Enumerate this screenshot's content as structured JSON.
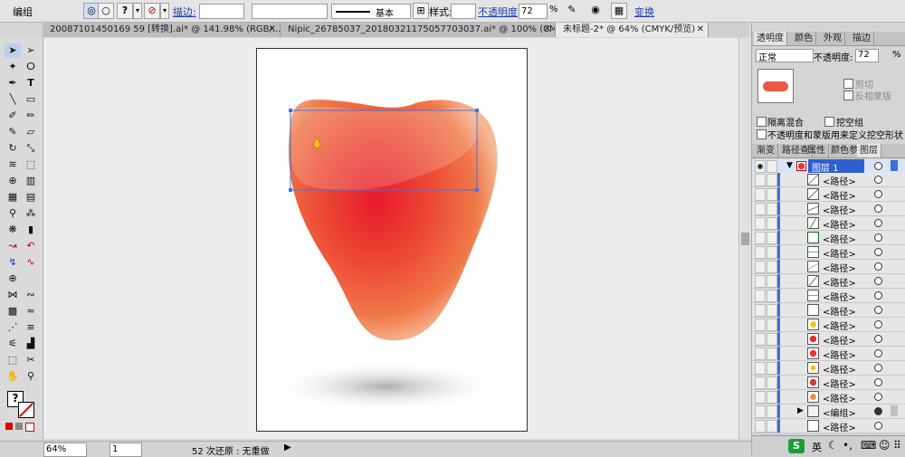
{
  "control_bar": {
    "mode_label": "编组",
    "stroke_label": "描边:",
    "brush_label": "基本",
    "style_label": "样式:",
    "opacity_label": "不透明度",
    "opacity_value": "72",
    "opacity_unit": "%",
    "transform_label": "变换"
  },
  "tabs": [
    {
      "label": "20087101450169 59 [转换].ai* @ 141.98% (RGB/...",
      "close": "✕"
    },
    {
      "label": "Nipic_26785037_20180321175057703037.ai* @ 100% (CMYK/...",
      "close": "✕"
    },
    {
      "label": "未标题-2* @ 64% (CMYK/预览)",
      "close": "✕"
    }
  ],
  "transparency_panel": {
    "tabs": [
      "透明度",
      "颜色",
      "外观",
      "描边"
    ],
    "blend_mode": "正常",
    "opacity_label": "不透明度:",
    "opacity_value": "72",
    "opacity_unit": "%",
    "clip_label": "剪切",
    "invert_mask_label": "反相蒙版",
    "isolate_blending_label": "隔离混合",
    "knockout_group_label": "挖空组",
    "opacity_mask_label": "不透明度和蒙版用来定义挖空形状"
  },
  "layers_panel": {
    "tabs": [
      "渐变",
      "路径查",
      "属性",
      "颜色参",
      "图层"
    ],
    "layer_name": "图层 1",
    "items": [
      "<路径>",
      "<路径>",
      "<路径>",
      "<路径>",
      "<路径>",
      "<路径>",
      "<路径>",
      "<路径>",
      "<路径>",
      "<路径>",
      "<路径>",
      "<路径>",
      "<路径>",
      "<路径>",
      "<路径>",
      "<路径>",
      "<编组>",
      "<路径>"
    ]
  },
  "status_bar": {
    "zoom": "64%",
    "page": "1",
    "undo_status": "52 次还原 : 无重做"
  },
  "colors": {
    "selection_blue": "#4a6fd8",
    "heart_center": "#e8192c",
    "heart_edge": "#f0784a"
  }
}
